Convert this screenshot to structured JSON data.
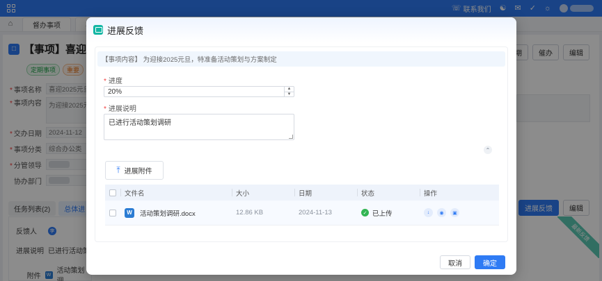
{
  "topbar": {
    "contact_label": "联系我们",
    "user_badge": "?"
  },
  "tabs": [
    {
      "label": "督办事项"
    },
    {
      "label": "喜"
    }
  ],
  "page": {
    "title": "【事项】喜迎2",
    "tags": [
      "定期事项",
      "重要"
    ],
    "fields": [
      {
        "label": "事项名称",
        "value": "喜迎2025元旦"
      },
      {
        "label": "事项内容",
        "value": "为迎接2025元"
      },
      {
        "label": "交办日期",
        "value": "2024-11-12"
      },
      {
        "label": "事项分类",
        "value": "综合办公类"
      },
      {
        "label": "分管领导",
        "value": ""
      },
      {
        "label": "协办部门",
        "value": ""
      }
    ],
    "header_buttons": [
      "延期",
      "催办",
      "编辑"
    ],
    "lower_tabs": [
      "任务列表(2)",
      "总体进"
    ],
    "lower_buttons": [
      "进展反馈",
      "编辑"
    ],
    "ribbon": "最新反馈",
    "feedback": {
      "person_label": "反馈人",
      "person_avatar": "李",
      "desc_label": "进展说明",
      "desc_value": "已进行活动策",
      "attach_label": "附件",
      "attach_value": "活动策划调"
    }
  },
  "modal": {
    "title": "进展反馈",
    "info_banner": "【事项内容】 为迎接2025元旦，特准备活动策划与方案制定",
    "progress_label": "进度",
    "progress_value": "20%",
    "desc_label": "进展说明",
    "desc_value": "已进行活动策划调研",
    "upload_label": "进展附件",
    "table": {
      "headers": [
        "文件名",
        "大小",
        "日期",
        "状态",
        "操作"
      ],
      "rows": [
        {
          "name": "活动策划调研.docx",
          "size": "12.86 KB",
          "date": "2024-11-13",
          "status": "已上传"
        }
      ]
    },
    "cancel_label": "取消",
    "confirm_label": "确定"
  },
  "colors": {
    "primary": "#2f7bf4",
    "success": "#33b553",
    "ribbon": "#5ac8b2",
    "modal_icon": "#13b6a4"
  },
  "icons": [
    "apps-grid-icon",
    "phone-icon",
    "accessibility-icon",
    "mail-icon",
    "check-circle-icon",
    "bulb-icon",
    "home-icon",
    "upload-icon",
    "word-file-icon",
    "download-icon",
    "eye-icon",
    "trash-icon",
    "chevron-up-icon"
  ]
}
